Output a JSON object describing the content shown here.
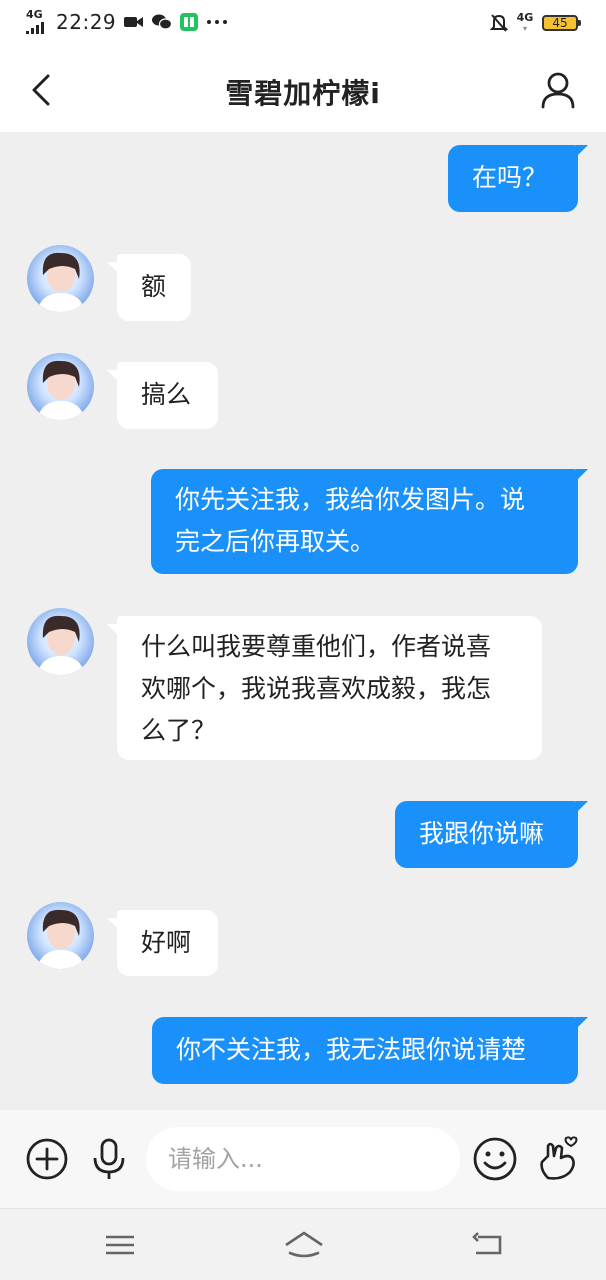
{
  "status_bar": {
    "network_left": "4G",
    "time": "22:29",
    "network_right": "4G",
    "battery_level": "45",
    "icons": [
      "video-icon",
      "wechat-icon",
      "reader-app-icon",
      "more-dots-icon",
      "mute-bell-icon"
    ]
  },
  "header": {
    "title": "雪碧加柠檬ⅰ",
    "back_icon": "chevron-left-icon",
    "profile_icon": "person-icon"
  },
  "messages": [
    {
      "side": "out",
      "text": "在吗？"
    },
    {
      "side": "in",
      "text": "额"
    },
    {
      "side": "in",
      "text": "搞么"
    },
    {
      "side": "out",
      "line1": "你先关注我，我给你发图片。说",
      "line2": "完之后你再取关。"
    },
    {
      "side": "in",
      "line1": "什么叫我要尊重他们，作者说喜",
      "line2": "欢哪个，我说我喜欢成毅，我怎",
      "line3": "么了？"
    },
    {
      "side": "out",
      "text": "我跟你说嘛"
    },
    {
      "side": "in",
      "text": "好啊"
    },
    {
      "side": "out",
      "text": "你不关注我，我无法跟你说请楚"
    }
  ],
  "input_bar": {
    "placeholder": "请输入...",
    "icons": [
      "add-circle-icon",
      "microphone-icon",
      "emoji-icon",
      "finger-heart-icon"
    ]
  },
  "nav_bar": {
    "icons": [
      "menu-icon",
      "home-icon",
      "back-icon"
    ]
  },
  "colors": {
    "outgoing_bubble": "#1990fa",
    "incoming_bubble": "#ffffff",
    "chat_background": "#efefef"
  }
}
